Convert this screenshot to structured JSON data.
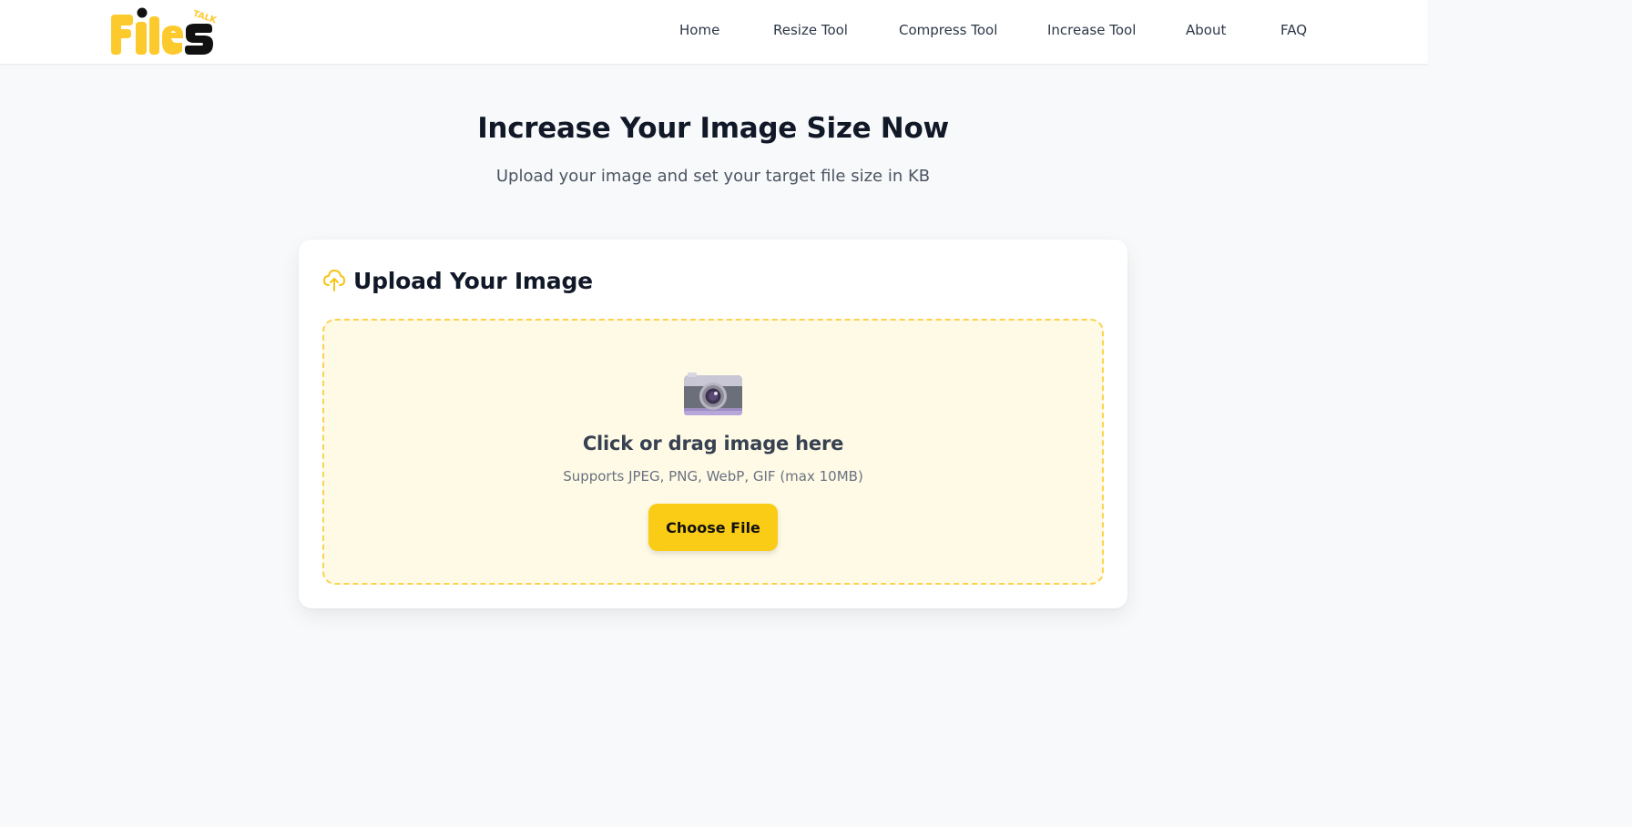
{
  "header": {
    "logo_text": "Files",
    "logo_tagline": "TALK",
    "nav": [
      {
        "label": "Home"
      },
      {
        "label": "Resize Tool"
      },
      {
        "label": "Compress Tool"
      },
      {
        "label": "Increase Tool"
      },
      {
        "label": "About"
      },
      {
        "label": "FAQ"
      }
    ]
  },
  "hero": {
    "title": "Increase Your Image Size Now",
    "subtitle": "Upload your image and set your target file size in KB"
  },
  "upload_card": {
    "title": "Upload Your Image",
    "title_icon": "cloud-upload-icon",
    "dropzone": {
      "icon": "camera-icon",
      "title": "Click or drag image here",
      "subtitle": "Supports JPEG, PNG, WebP, GIF (max 10MB)",
      "button_label": "Choose File"
    }
  },
  "colors": {
    "accent": "#facc15",
    "dropzone_bg": "#fefae6",
    "dropzone_border": "#fcd34d",
    "page_bg": "#f8f9fa",
    "text_dark": "#111827"
  }
}
